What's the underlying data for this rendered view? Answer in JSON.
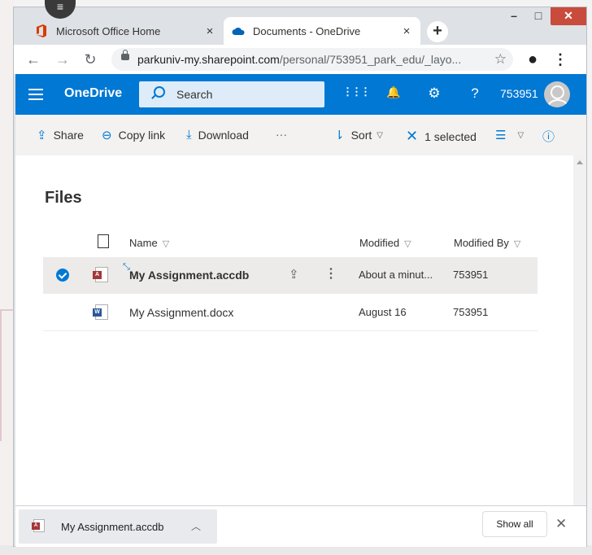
{
  "browser": {
    "tabs": [
      {
        "title": "Microsoft Office Home",
        "close": "×"
      },
      {
        "title": "Documents - OneDrive",
        "close": "×"
      }
    ],
    "new_tab": "+",
    "window_buttons": {
      "minimize": "–",
      "maximize": "□",
      "close": "✕"
    },
    "nav": {
      "back": "←",
      "forward": "→",
      "reload": "↻"
    },
    "url_host": "parkuniv-my.sharepoint.com",
    "url_path": "/personal/753951_park_edu/_layo...",
    "bookmark": "☆",
    "menu": "⋮",
    "profile": "●"
  },
  "suite_bar": {
    "brand": "OneDrive",
    "search_placeholder": "Search",
    "user_id": "753951",
    "icons": {
      "apps": "⋮⋮⋮",
      "notifications": "🔔",
      "settings": "⚙",
      "help": "?"
    }
  },
  "command_bar": {
    "share": "Share",
    "copy_link": "Copy link",
    "download": "Download",
    "more": "···",
    "sort": "Sort",
    "selected": "1 selected",
    "info": "ⓘ"
  },
  "files": {
    "title": "Files",
    "columns": {
      "name": "Name",
      "modified": "Modified",
      "modified_by": "Modified By"
    },
    "rows": [
      {
        "name": "My Assignment.accdb",
        "modified": "About a minut...",
        "modified_by": "753951",
        "type": "access",
        "badge": "A",
        "selected": true
      },
      {
        "name": "My Assignment.docx",
        "modified": "August 16",
        "modified_by": "753951",
        "type": "word",
        "badge": "W",
        "selected": false
      }
    ]
  },
  "downloads": {
    "item_name": "My Assignment.accdb",
    "item_badge": "A",
    "show_all": "Show all",
    "close": "✕"
  },
  "colors": {
    "onedrive_blue": "#0078d4",
    "access_red": "#a4373a",
    "word_blue": "#2b579a"
  }
}
